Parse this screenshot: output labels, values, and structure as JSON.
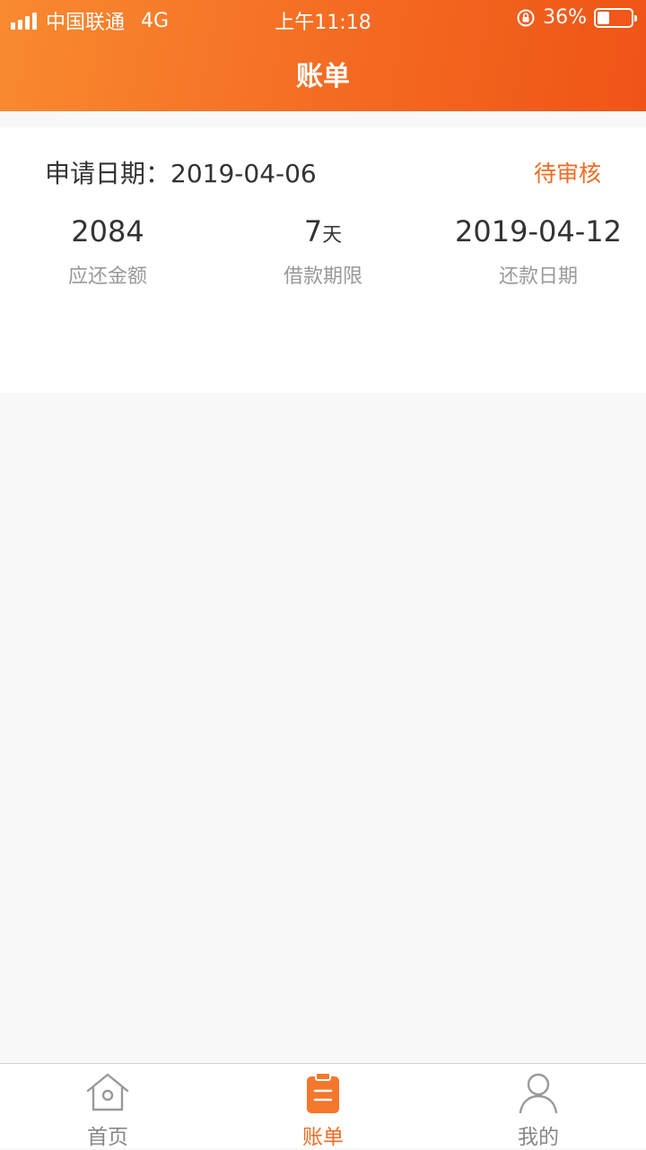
{
  "status_bar": {
    "carrier": "中国联通",
    "network": "4G",
    "time": "上午11:18",
    "battery": "36%",
    "battery_level": 0.36
  },
  "header": {
    "title": "账单"
  },
  "bill": {
    "apply_label": "申请日期：",
    "apply_date": "2019-04-06",
    "status": "待审核",
    "metrics": [
      {
        "value": "2084",
        "unit": "",
        "label": "应还金额"
      },
      {
        "value": "7",
        "unit": "天",
        "label": "借款期限"
      },
      {
        "value": "2019-04-12",
        "unit": "",
        "label": "还款日期"
      }
    ]
  },
  "tabbar": {
    "items": [
      {
        "label": "首页",
        "icon": "home-icon",
        "active": false
      },
      {
        "label": "账单",
        "icon": "bill-icon",
        "active": true
      },
      {
        "label": "我的",
        "icon": "user-icon",
        "active": false
      }
    ]
  },
  "colors": {
    "accent": "#f26b22",
    "header_start": "#f98a30",
    "header_end": "#ef5416",
    "text_primary": "#333333",
    "text_secondary": "#999999",
    "tab_inactive": "#888888"
  }
}
